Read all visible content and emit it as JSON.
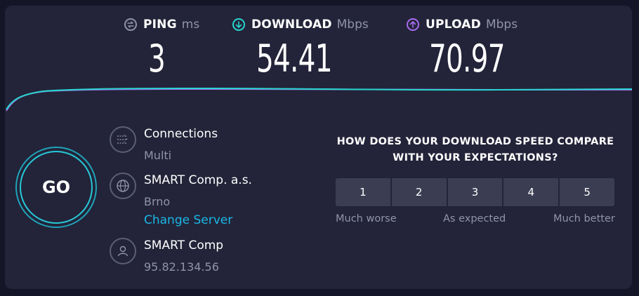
{
  "metrics": {
    "ping": {
      "label": "PING",
      "unit": "ms",
      "value": "3",
      "icon": "ping-icon"
    },
    "download": {
      "label": "DOWNLOAD",
      "unit": "Mbps",
      "value": "54.41",
      "icon": "download-arrow-icon"
    },
    "upload": {
      "label": "UPLOAD",
      "unit": "Mbps",
      "value": "70.97",
      "icon": "upload-arrow-icon"
    }
  },
  "go": {
    "label": "GO"
  },
  "server": {
    "connections_title": "Connections",
    "connections_value": "Multi",
    "host_name": "SMART Comp. a.s.",
    "host_location": "Brno",
    "change_server": "Change Server",
    "provider_name": "SMART Comp",
    "provider_ip": "95.82.134.56"
  },
  "survey": {
    "question_line1": "HOW DOES YOUR DOWNLOAD SPEED COMPARE",
    "question_line2": "WITH YOUR EXPECTATIONS?",
    "options": [
      "1",
      "2",
      "3",
      "4",
      "5"
    ],
    "scale_low": "Much worse",
    "scale_mid": "As expected",
    "scale_high": "Much better"
  },
  "colors": {
    "background": "#141526",
    "panel": "#232439",
    "download_accent": "#26d5cf",
    "upload_accent": "#a86bf0",
    "link": "#1ab8e6"
  }
}
